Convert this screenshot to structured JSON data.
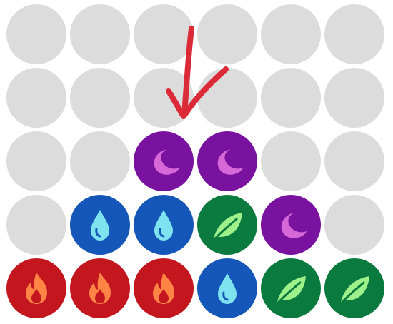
{
  "board": {
    "rows": 5,
    "cols": 6,
    "cells": [
      [
        "empty",
        "empty",
        "empty",
        "empty",
        "empty",
        "empty"
      ],
      [
        "empty",
        "empty",
        "empty",
        "empty",
        "empty",
        "empty"
      ],
      [
        "empty",
        "empty",
        "moon",
        "moon",
        "empty",
        "empty"
      ],
      [
        "empty",
        "water",
        "water",
        "leaf",
        "moon",
        "empty"
      ],
      [
        "fire",
        "fire",
        "fire",
        "water",
        "leaf",
        "leaf"
      ]
    ]
  },
  "pieces": {
    "empty": {
      "bg": "#dcdcdc",
      "icon": "none"
    },
    "moon": {
      "bg": "#7a12a0",
      "fg": "#d768d8",
      "icon": "crescent-moon-icon"
    },
    "water": {
      "bg": "#1557b8",
      "fg": "#7ee2ef",
      "icon": "water-drop-icon"
    },
    "leaf": {
      "bg": "#0b7a3e",
      "fg": "#9ef08a",
      "icon": "leaf-icon"
    },
    "fire": {
      "bg": "#c3161e",
      "fg": "#ff8446",
      "icon": "flame-icon"
    }
  },
  "annotation": {
    "arrow_color": "#dc2b38",
    "arrow_icon": "hand-drawn-down-arrow-icon",
    "target_column": 3
  }
}
